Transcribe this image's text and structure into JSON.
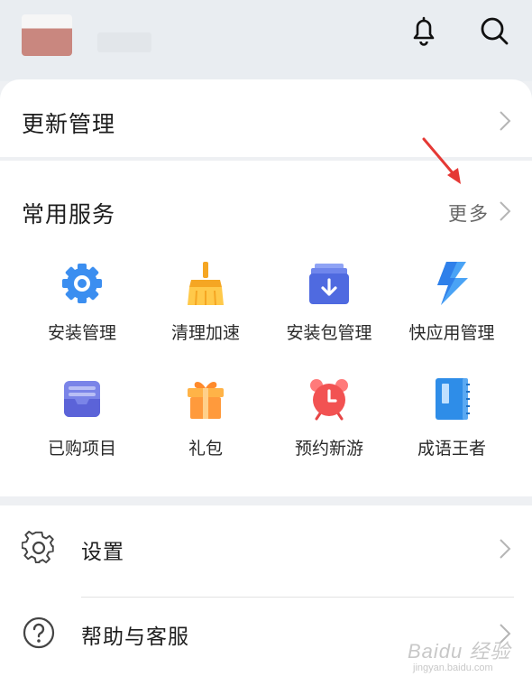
{
  "header": {
    "bell_icon": "bell-icon",
    "search_icon": "search-icon"
  },
  "update": {
    "title": "更新管理"
  },
  "services": {
    "title": "常用服务",
    "more_label": "更多",
    "items": [
      {
        "label": "安装管理",
        "icon": "gear-icon"
      },
      {
        "label": "清理加速",
        "icon": "broom-icon"
      },
      {
        "label": "安装包管理",
        "icon": "package-download-icon"
      },
      {
        "label": "快应用管理",
        "icon": "lightning-icon"
      },
      {
        "label": "已购项目",
        "icon": "purchased-tray-icon"
      },
      {
        "label": "礼包",
        "icon": "gift-icon"
      },
      {
        "label": "预约新游",
        "icon": "alarm-clock-icon"
      },
      {
        "label": "成语王者",
        "icon": "book-icon"
      }
    ]
  },
  "settings": {
    "items": [
      {
        "label": "设置",
        "icon": "settings-gear-icon"
      },
      {
        "label": "帮助与客服",
        "icon": "help-icon"
      }
    ]
  },
  "watermark": {
    "text": "Baidu 经验",
    "url": "jingyan.baidu.com"
  },
  "colors": {
    "accent_blue": "#3b8ef0",
    "red_arrow": "#e53935"
  }
}
